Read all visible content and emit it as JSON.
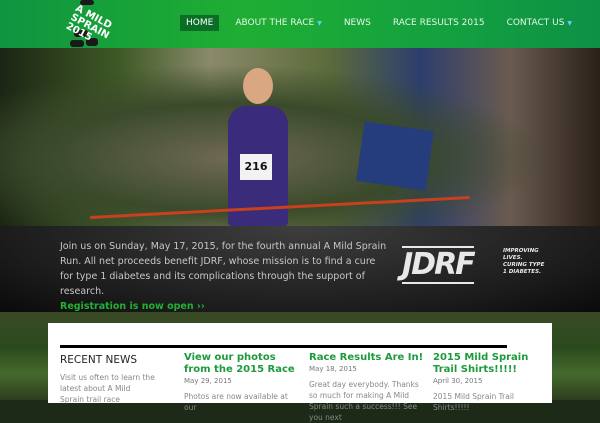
{
  "logo": {
    "text": "A MILD\nSPRAIN\n2015"
  },
  "nav": [
    {
      "label": "HOME",
      "active": true
    },
    {
      "label": "ABOUT THE RACE",
      "dropdown": true
    },
    {
      "label": "NEWS"
    },
    {
      "label": "RACE RESULTS 2015"
    },
    {
      "label": "CONTACT US",
      "dropdown": true
    }
  ],
  "hero": {
    "bib_number": "216",
    "slides": 5,
    "active_slide": 1
  },
  "intro": {
    "text": "Join us on Sunday, May 17, 2015, for the fourth annual A Mild Sprain Run. All net proceeds benefit JDRF, whose mission is to find a cure for type 1 diabetes and its complications through the support of research.",
    "link": "Registration is now open ››"
  },
  "sponsor": {
    "name": "JDRF",
    "tagline": "IMPROVING LIVES. CURING TYPE 1 DIABETES."
  },
  "recent_news": {
    "heading": "RECENT NEWS",
    "text": "Visit us often to learn the latest about A Mild Sprain trail race"
  },
  "posts": [
    {
      "title": "View our photos from the 2015 Race",
      "date": "May 29, 2015",
      "excerpt": "Photos are now available at our"
    },
    {
      "title": "Race Results Are In!",
      "date": "May 18, 2015",
      "excerpt": "Great day everybody. Thanks so much for making A Mild Sprain such a success!!! See you next"
    },
    {
      "title": "2015 Mild Sprain Trail Shirts!!!!!",
      "date": "April 30, 2015",
      "excerpt": "2015 Mild Sprain Trail Shirts!!!!!"
    }
  ],
  "colors": {
    "brand_green": "#1fae33",
    "link_green": "#1c9b3c"
  }
}
